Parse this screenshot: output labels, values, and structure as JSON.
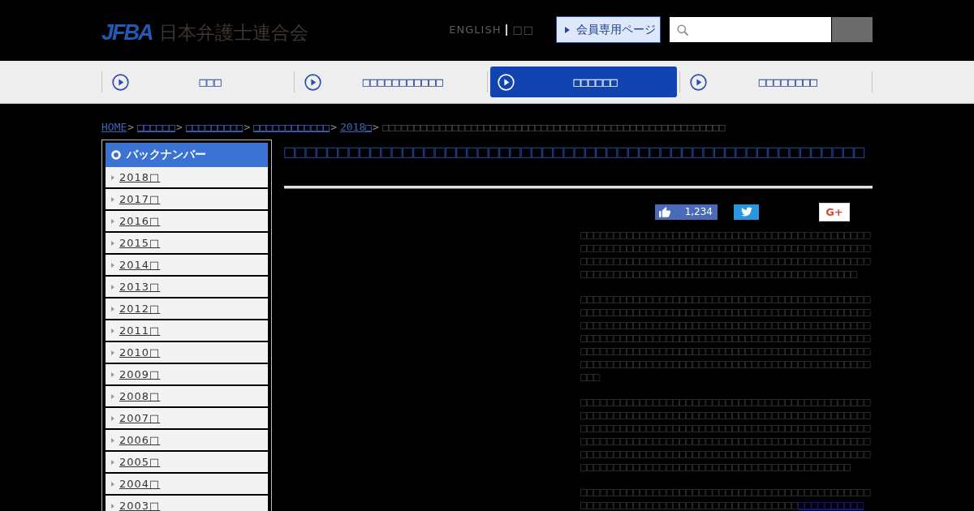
{
  "header": {
    "logo": {
      "mark": "JFBA",
      "name": "日本弁護士連合会"
    },
    "language_links": [
      "ENGLISH",
      "□□"
    ],
    "member_button": "会員専用ページ"
  },
  "nav": [
    {
      "label": "□□□",
      "selected": false
    },
    {
      "label": "□□□□□□□□□□□",
      "selected": false
    },
    {
      "label": "□□□□□□",
      "selected": true
    },
    {
      "label": "□□□□□□□□",
      "selected": false
    }
  ],
  "breadcrumb": [
    {
      "kind": "link",
      "label": "HOME"
    },
    {
      "kind": "separator",
      "label": ">"
    },
    {
      "kind": "link",
      "label": "□□□□□□"
    },
    {
      "kind": "separator",
      "label": ">"
    },
    {
      "kind": "link",
      "label": "□□□□□□□□□"
    },
    {
      "kind": "separator",
      "label": ">"
    },
    {
      "kind": "link",
      "label": "□□□□□□□□□□□□"
    },
    {
      "kind": "separator",
      "label": ">"
    },
    {
      "kind": "link",
      "label": "2018□"
    },
    {
      "kind": "separator",
      "label": ">"
    },
    {
      "kind": "current",
      "label": "□□□□□□□□□□□□□□□□□□□□□□□□□□□□□□□□□□□□□□□□□□□□□□□□□□□□□□"
    }
  ],
  "sidebar": {
    "title": "バックナンバー",
    "items": [
      "2018□",
      "2017□",
      "2016□",
      "2015□",
      "2014□",
      "2013□",
      "2012□",
      "2011□",
      "2010□",
      "2009□",
      "2008□",
      "2007□",
      "2006□",
      "2005□",
      "2004□",
      "2003□"
    ]
  },
  "article": {
    "title": "□□□□□□□□□□□□□□□□□□□□□□□□□□□□□□□□□□□□□□□□□□□□□□□□□□□□□□",
    "share": {
      "like_count": "1,234",
      "plus_label": "G+"
    },
    "paragraphs": [
      {
        "text": "□□□□□□□□□□□□□□□□□□□□□□□□□□□□□□□□□□□□□□□□□□□□□□□□□□□□□□□□□□□□□□□□□□□□□□□□□□□□□□□□□□□□□□□□□□□□□□□□□□□□□□□□□□□□□□□□□□□□□□□□□□□□□□□□□□□□□□□□□□□□□□□□□□□□□□□□□□□□□□□□□□□□□□□□□□□□□□"
      },
      {
        "text": "□□□□□□□□□□□□□□□□□□□□□□□□□□□□□□□□□□□□□□□□□□□□□□□□□□□□□□□□□□□□□□□□□□□□□□□□□□□□□□□□□□□□□□□□□□□□□□□□□□□□□□□□□□□□□□□□□□□□□□□□□□□□□□□□□□□□□□□□□□□□□□□□□□□□□□□□□□□□□□□□□□□□□□□□□□□□□□□□□□□□□□□□□□□□□□□□□□□□□□□□□□□□□□□□□□□□□□□□□□□□□□□□□□□□□□□□□□□□□□□□□□□□□□□□□□□□□□□□□□□□□□□□□□□"
      },
      {
        "text": "□□□□□□□□□□□□□□□□□□□□□□□□□□□□□□□□□□□□□□□□□□□□□□□□□□□□□□□□□□□□□□□□□□□□□□□□□□□□□□□□□□□□□□□□□□□□□□□□□□□□□□□□□□□□□□□□□□□□□□□□□□□□□□□□□□□□□□□□□□□□□□□□□□□□□□□□□□□□□□□□□□□□□□□□□□□□□□□□□□□□□□□□□□□□□□□□□□□□□□□□□□□□□□□□□□□□□□□□□□□□□□□□□□□□□□□□□□□□□□□□□□□□□□□□□□□□□□□□□□□□□"
      },
      {
        "text": "□□□□□□□□□□□□□□□□□□□□□□□□□□□□□□□□□□□□□□□□□□□□□□□□□□□□□□□□□□□□□□□□□□□□□□□□□□□□□",
        "link": "□□□□□□□□□□"
      }
    ]
  }
}
